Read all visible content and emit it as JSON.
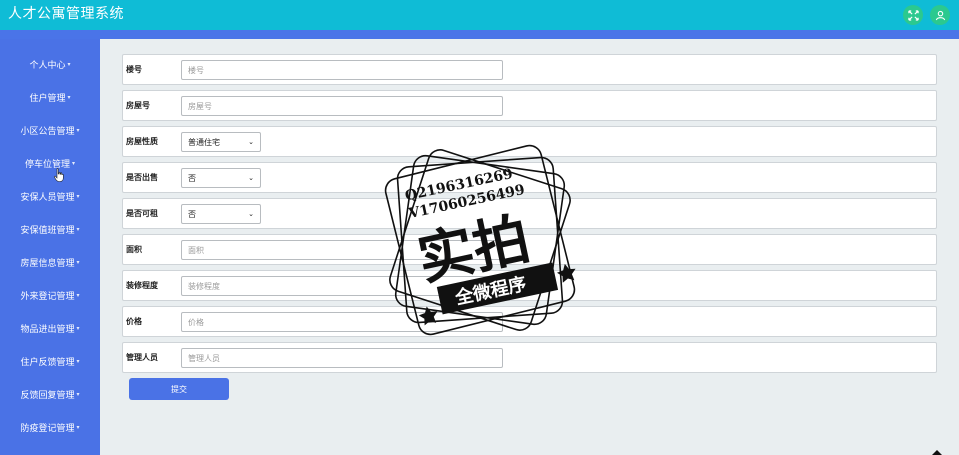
{
  "app": {
    "title": "人才公寓管理系统"
  },
  "header": {
    "fullscreen_icon": "expand-icon",
    "user_icon": "user-icon",
    "accent": "#0fbcd6",
    "button_color": "#2bc98f"
  },
  "sidebar": {
    "color": "#4a72e6",
    "items": [
      {
        "label": "个人中心"
      },
      {
        "label": "住户管理"
      },
      {
        "label": "小区公告管理"
      },
      {
        "label": "停车位管理"
      },
      {
        "label": "安保人员管理"
      },
      {
        "label": "安保值班管理"
      },
      {
        "label": "房屋信息管理"
      },
      {
        "label": "外来登记管理"
      },
      {
        "label": "物品进出管理"
      },
      {
        "label": "住户反馈管理"
      },
      {
        "label": "反馈回复管理"
      },
      {
        "label": "防疫登记管理"
      }
    ]
  },
  "form": {
    "building": {
      "label": "楼号",
      "placeholder": "楼号"
    },
    "room": {
      "label": "房屋号",
      "placeholder": "房屋号"
    },
    "house_type": {
      "label": "房屋性质",
      "value": "普通住宅"
    },
    "for_sale": {
      "label": "是否出售",
      "value": "否"
    },
    "for_rent": {
      "label": "是否可租",
      "value": "否"
    },
    "area": {
      "label": "面积",
      "placeholder": "面积"
    },
    "decoration": {
      "label": "装修程度",
      "placeholder": "装修程度"
    },
    "price": {
      "label": "价格",
      "placeholder": "价格"
    },
    "manager": {
      "label": "管理人员",
      "placeholder": "管理人员"
    },
    "submit_label": "提交"
  },
  "watermark": {
    "line1": "Q2196316269",
    "line2": "V17060256499",
    "main": "实拍",
    "banner": "全微程序"
  }
}
